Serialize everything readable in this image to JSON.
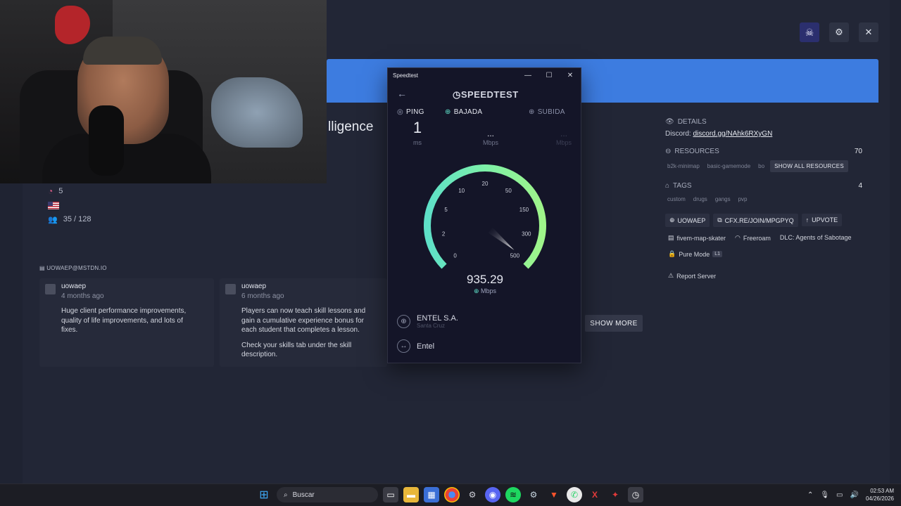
{
  "page": {
    "title_fragment": "lligence"
  },
  "stats": {
    "upvotes": "5",
    "players": "35 / 128"
  },
  "posts": {
    "account": "UOWAEP@MSTDN.IO",
    "items": [
      {
        "author": "uowaep",
        "when": "4 months ago",
        "paragraphs": [
          "Huge client performance improvements, quality of life improvements, and lots of fixes."
        ]
      },
      {
        "author": "uowaep",
        "when": "6 months ago",
        "paragraphs": [
          "Players can now teach skill lessons and gain a cumulative experience bonus for each student that completes a lesson.",
          "Check your skills tab under the skill description."
        ]
      }
    ],
    "show_more_label": "SHOW MORE"
  },
  "details": {
    "details_title": "DETAILS",
    "discord_label": "Discord:",
    "discord_link": "discord.gg/NAhk6RXyGN",
    "resources_title": "RESOURCES",
    "resources_count": "70",
    "resources": [
      "b2k-minimap",
      "basic-gamemode",
      "bo"
    ],
    "show_all_label": "SHOW ALL RESOURCES",
    "tags_title": "TAGS",
    "tags_count": "4",
    "tags": [
      "custom",
      "drugs",
      "gangs",
      "pvp"
    ],
    "owner_label": "UOWAEP",
    "join_label": "CFX.RE/JOIN/MPGPYQ",
    "upvote_label": "UPVOTE",
    "map_label": "fivem-map-skater",
    "mode_label": "Freeroam",
    "dlc_label": "DLC: Agents of Sabotage",
    "pure_mode_label": "Pure Mode",
    "pure_mode_level": "L1",
    "report_label": "Report Server"
  },
  "speedtest": {
    "window_title": "Speedtest",
    "logo": "SPEEDTEST",
    "ping_label": "PING",
    "download_label": "BAJADA",
    "upload_label": "SUBIDA",
    "ping_value": "1",
    "ping_unit": "ms",
    "download_value": "...",
    "download_unit": "Mbps",
    "upload_value": "...",
    "upload_unit": "Mbps",
    "gauge_ticks": [
      "0",
      "2",
      "5",
      "10",
      "20",
      "50",
      "150",
      "300",
      "500"
    ],
    "current_speed": "935.29",
    "current_unit": "Mbps",
    "isp_name": "ENTEL S.A.",
    "isp_location": "Santa Cruz",
    "server_name": "Entel",
    "colors": {
      "gauge_start": "#5ee0c8",
      "gauge_end": "#8ff58f",
      "bg": "#141528"
    }
  },
  "taskbar": {
    "search_label": "Buscar",
    "time": "02:53 AM",
    "date": "04/26/2026"
  }
}
